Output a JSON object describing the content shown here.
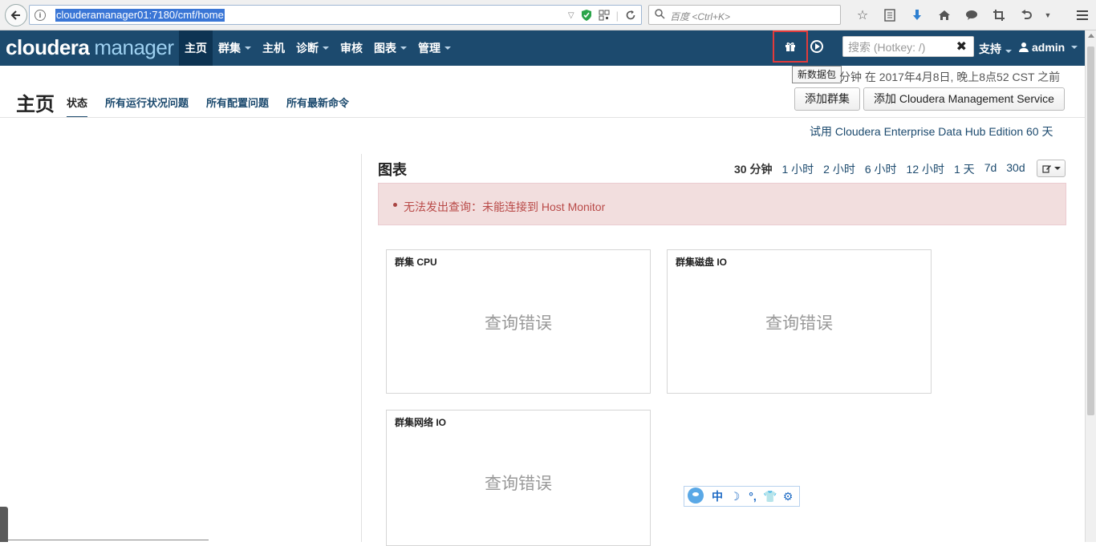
{
  "browser": {
    "url": "clouderamanager01:7180/cmf/home",
    "search_placeholder": "百度 <Ctrl+K>"
  },
  "navbar": {
    "logo_part1": "cloudera",
    "logo_part2": "manager",
    "items": [
      {
        "label": "主页",
        "active": true,
        "dropdown": false
      },
      {
        "label": "群集",
        "active": false,
        "dropdown": true
      },
      {
        "label": "主机",
        "active": false,
        "dropdown": false
      },
      {
        "label": "诊断",
        "active": false,
        "dropdown": true
      },
      {
        "label": "审核",
        "active": false,
        "dropdown": false
      },
      {
        "label": "图表",
        "active": false,
        "dropdown": true
      },
      {
        "label": "管理",
        "active": false,
        "dropdown": true
      }
    ],
    "search_placeholder": "搜索 (Hotkey: /)",
    "support_label": "支持",
    "user_label": "admin"
  },
  "tooltip": "新数据包",
  "updated_text": "分钟 在 2017年4月8日, 晚上8点52 CST 之前",
  "page": {
    "title": "主页",
    "tabs": [
      "状态",
      "所有运行状况问题",
      "所有配置问题",
      "所有最新命令"
    ],
    "add_cluster_label": "添加群集",
    "add_mgmt_label": "添加 Cloudera Management Service",
    "trial_link": "试用 Cloudera Enterprise Data Hub Edition 60 天"
  },
  "charts": {
    "title": "图表",
    "time_ranges": [
      "30 分钟",
      "1 小时",
      "2 小时",
      "6 小时",
      "12 小时",
      "1 天",
      "7d",
      "30d"
    ],
    "alert_message": "无法发出查询：未能连接到 Host Monitor",
    "cards": [
      {
        "title": "群集 CPU",
        "error": "查询错误"
      },
      {
        "title": "群集磁盘 IO",
        "error": "查询错误"
      },
      {
        "title": "群集网络 IO",
        "error": "查询错误"
      }
    ]
  },
  "ime": {
    "items": [
      "中",
      "☽",
      "°,",
      "👕",
      "⚙"
    ]
  }
}
